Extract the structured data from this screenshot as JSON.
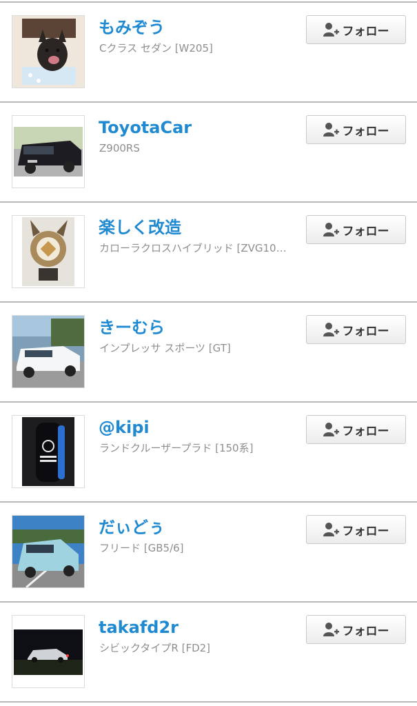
{
  "follow_label": "フォロー",
  "follow_icon": "add-user-icon",
  "colors": {
    "user_name": "#1f8ad1",
    "car_name": "#8e8e8e",
    "divider": "#b8b8b8"
  },
  "users": [
    {
      "name": "もみぞう",
      "car": "Cクラス セダン [W205]",
      "avatar": "french-bulldog-photo"
    },
    {
      "name": "ToyotaCar",
      "car": "Z900RS",
      "avatar": "black-minivan-photo"
    },
    {
      "name": "楽しく改造",
      "car": "カローラクロスハイブリッド [ZVG10…",
      "avatar": "plush-figure-photo"
    },
    {
      "name": "きーむら",
      "car": "インプレッサ スポーツ [GT]",
      "avatar": "white-hatchback-photo"
    },
    {
      "name": "@kipi",
      "car": "ランドクルーザープラド [150系]",
      "avatar": "car-key-photo"
    },
    {
      "name": "だぃどぅ",
      "car": "フリード [GB5/6]",
      "avatar": "light-blue-minivan-photo"
    },
    {
      "name": "takafd2r",
      "car": "シビックタイプR [FD2]",
      "avatar": "night-car-photo"
    }
  ]
}
